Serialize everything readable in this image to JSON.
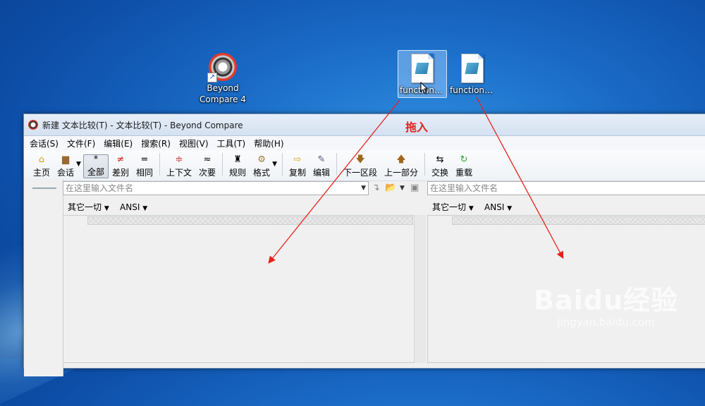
{
  "desktop": {
    "icons": [
      {
        "label_line1": "Beyond",
        "label_line2": "Compare 4"
      },
      {
        "label": "function...."
      },
      {
        "label": "function1...."
      }
    ],
    "drag_label": "拖入"
  },
  "window": {
    "title": "新建 文本比较(T) - 文本比较(T) - Beyond Compare",
    "menu": [
      "会话(S)",
      "文件(F)",
      "编辑(E)",
      "搜索(R)",
      "视图(V)",
      "工具(T)",
      "帮助(H)"
    ],
    "toolbar": {
      "home": "主页",
      "session": "会话",
      "all": "全部",
      "diff": "差别",
      "same": "相同",
      "context": "上下文",
      "minor": "次要",
      "rules": "规则",
      "format": "格式",
      "copy": "复制",
      "edit": "编辑",
      "next_section": "下一区段",
      "prev_part": "上一部分",
      "swap": "交换",
      "reload": "重载"
    },
    "left_path_placeholder": "在这里输入文件名",
    "right_path_placeholder": "在这里输入文件名",
    "left_filter": "其它一切",
    "left_encoding": "ANSI",
    "right_filter": "其它一切",
    "right_encoding": "ANSI"
  },
  "watermark": {
    "brand": "Baidu经验",
    "url": "jingyan.baidu.com"
  },
  "colors": {
    "arrow": "#e8201a",
    "accent": "#1a6bc6"
  }
}
